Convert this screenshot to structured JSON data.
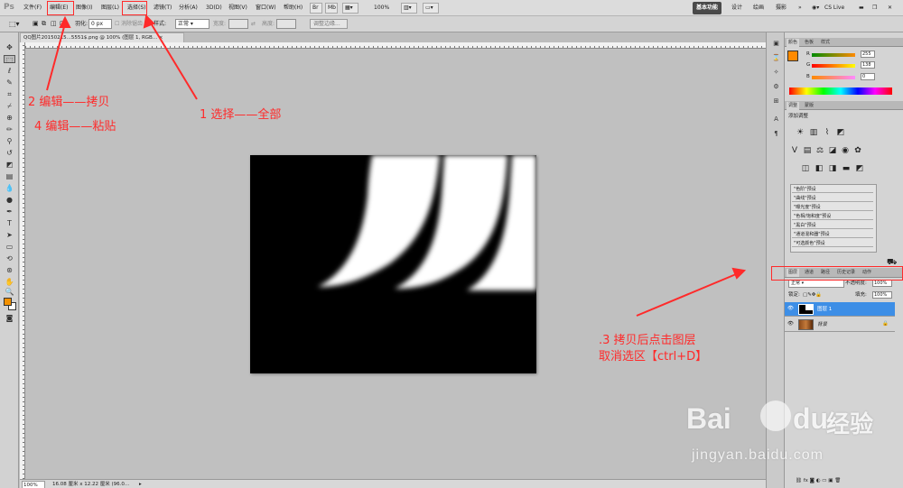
{
  "menubar": {
    "logo": "Ps",
    "items": [
      "文件(F)",
      "编辑(E)",
      "图像(I)",
      "图层(L)",
      "选择(S)",
      "滤镜(T)",
      "分析(A)",
      "3D(D)",
      "视图(V)",
      "窗口(W)",
      "帮助(H)"
    ],
    "zoom": "100%",
    "workspaces": [
      "基本功能",
      "设计",
      "绘画",
      "摄影"
    ],
    "cs_live": "CS Live"
  },
  "options_bar": {
    "feather_label": "羽化:",
    "feather_value": "0 px",
    "antialias_label": "消除锯齿",
    "style_label": "样式:",
    "style_value": "正常",
    "width_label": "宽度:",
    "height_label": "高度:",
    "refine_edge": "调整边缘..."
  },
  "document": {
    "tab_title": "QQ图片20150215...5551$.png @ 100% (图层 1, RGB..."
  },
  "status_bar": {
    "zoom": "100%",
    "doc_info": "16.08 厘米 x 12.22 厘米 (96.0..."
  },
  "color_panel": {
    "tabs": [
      "颜色",
      "色板",
      "样式"
    ],
    "r_label": "R",
    "r_value": "255",
    "g_label": "G",
    "g_value": "138",
    "b_label": "B",
    "b_value": "0",
    "fg_color": "#ff8a00"
  },
  "adjustments_panel": {
    "tabs": [
      "调整",
      "蒙版"
    ],
    "title": "添加调整",
    "presets": [
      "\"色阶\"预设",
      "\"曲线\"预设",
      "\"曝光度\"预设",
      "\"色相/饱和度\"预设",
      "\"黑白\"预设",
      "\"通道混和器\"预设",
      "\"可选颜色\"预设"
    ]
  },
  "layers_panel": {
    "tabs": [
      "图层",
      "通道",
      "路径",
      "历史记录",
      "动作"
    ],
    "blend_mode": "正常",
    "opacity_label": "不透明度:",
    "opacity_value": "100%",
    "lock_label": "锁定:",
    "fill_label": "填充:",
    "fill_value": "100%",
    "layers": [
      {
        "name": "图层 1",
        "selected": true
      },
      {
        "name": "背景",
        "selected": false
      }
    ]
  },
  "annotations": {
    "step1": "1    选择——全部",
    "step2": "2 编辑——拷贝",
    "step4": "4  编辑——粘贴",
    "step3_line1": ".3  拷贝后点击图层",
    "step3_line2": "取消选区【ctrl+D】",
    "color": "#ff2a2a"
  },
  "watermark": {
    "brand": "Bai",
    "brand2": "du",
    "chinese": "经验",
    "url": "jingyan.baidu.com"
  }
}
